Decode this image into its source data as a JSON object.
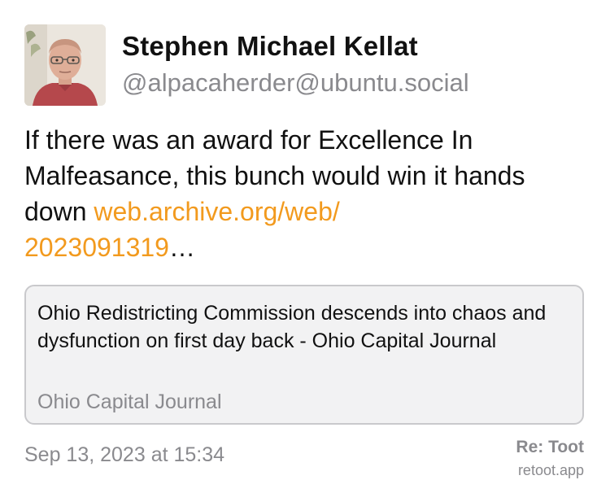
{
  "author": {
    "display_name": "Stephen Michael Kellat",
    "handle": "@alpacaherder@ubuntu.social",
    "avatar_icon": "user-avatar-photo"
  },
  "post": {
    "text": "If there was an award for Excellence In Malfeasance, this bunch would win it hands down ",
    "link_line1": "web.archive.org/web/",
    "link_line2": "2023091319",
    "link_ellipsis": "…"
  },
  "link_preview": {
    "title": "Ohio Redistricting Commission descends into chaos and dysfunction on first day back - Ohio Capital Journal",
    "source": "Ohio Capital Journal"
  },
  "footer": {
    "timestamp": "Sep 13, 2023 at 15:34",
    "brand_title": "Re: Toot",
    "brand_sub": "retoot.app"
  },
  "colors": {
    "link": "#f29a1e",
    "muted": "#8a8a8e",
    "card_bg": "#f2f2f3",
    "card_border": "#c9c9cc"
  }
}
